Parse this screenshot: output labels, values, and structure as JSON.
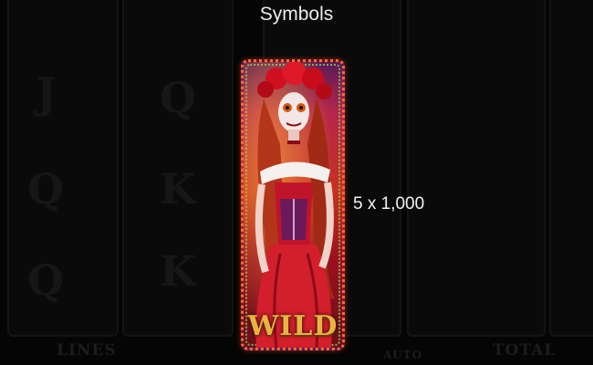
{
  "title": "Symbols",
  "symbol": {
    "name": "wild-symbol",
    "label": "WILD",
    "payout": "5 x 1,000"
  },
  "background": {
    "reel_symbols": [
      "J",
      "Q",
      "K",
      "Q",
      "K",
      "Q"
    ],
    "bottom_labels": [
      "LINES",
      "AUTO",
      "TOTAL"
    ]
  },
  "colors": {
    "background": "#050505",
    "frame_dots": "#ff6a3a",
    "wild_gold": "#e8b440"
  }
}
